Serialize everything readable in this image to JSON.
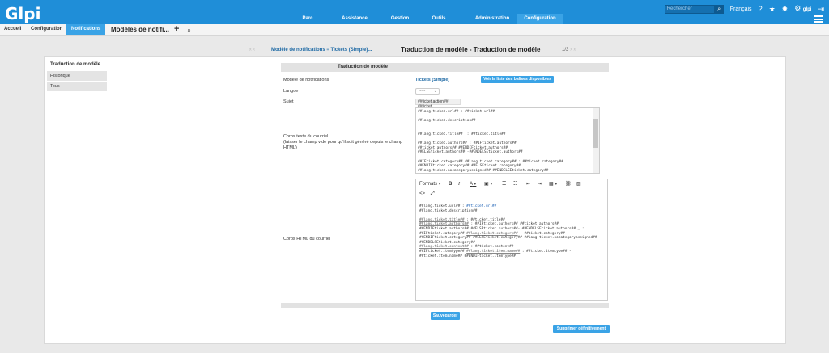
{
  "app": {
    "logo": "Glpi"
  },
  "topright": {
    "search_placeholder": "Rechercher",
    "language": "Français",
    "user": "glpi",
    "icons": [
      "search-icon",
      "help-icon",
      "star-icon",
      "bug-icon",
      "gear-icon",
      "logout-icon"
    ]
  },
  "menu": {
    "items": [
      "Parc",
      "Assistance",
      "Gestion",
      "Outils",
      "Administration",
      "Configuration"
    ],
    "active": "Configuration"
  },
  "breadcrumb": {
    "home": "Accueil",
    "config": "Configuration",
    "notifications": "Notifications",
    "title": "Modèles de notifi..."
  },
  "nav": {
    "arrows_left": "« ‹",
    "link": "Modèle de notifications = Tickets (Simple)...",
    "title": "Traduction de modèle - Traduction de modèle",
    "count": "1/3",
    "arrows_right": "› »"
  },
  "tabs": [
    "Traduction de modèle",
    "Historique",
    "Tous"
  ],
  "form": {
    "header": "Traduction de modèle",
    "template_label": "Modèle de notifications",
    "template_value": "Tickets (Simple)",
    "show_tags_button": "Voir la liste des balises disponibles",
    "language_label": "Langue",
    "language_value": "-----",
    "subject_label": "Sujet",
    "subject_value": "##ticket.action## ##ticket",
    "text_body_label": "Corps texte du courriel\n(laisser le champ vide pour qu'il soit généré depuis le champ HTML)",
    "text_body_content": "##lang.ticket.url## : ##ticket.url##\n\n##lang.ticket.description##\n\n\n##lang.ticket.title##  : ##ticket.title##\n\n##lang.ticket.authors## : ##IFticket.authors##\n##ticket.authors## ##ENDIFticket.authors##\n##ELSEticket.authors##--##ENDELSEticket.authors##\n\n##IFticket.category## ##lang.ticket.category## : ##ticket.category##\n##ENDIFticket.category## ##ELSEticket.category##\n##lang.ticket.nocategoryassigned## ##ENDELSEticket.category##",
    "html_body_label": "Corps HTML du courriel",
    "editor_toolbar": [
      "Formats",
      "B",
      "I",
      "A",
      "Ab",
      "list-bullet-icon",
      "list-number-icon",
      "outdent-icon",
      "indent-icon",
      "table-icon",
      "link-icon",
      "image-icon",
      "code-icon",
      "fullscreen-icon"
    ],
    "save_button": "Sauvegarder",
    "delete_button": "Supprimer définitivement"
  }
}
